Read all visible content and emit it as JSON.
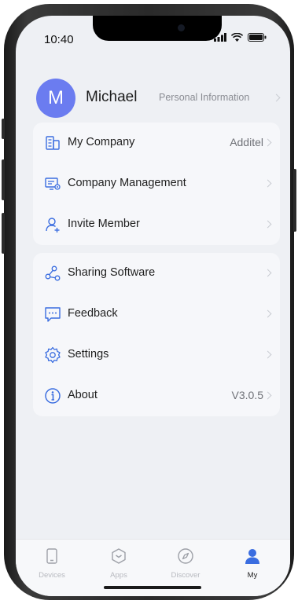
{
  "status": {
    "time": "10:40"
  },
  "profile": {
    "initial": "M",
    "name": "Michael",
    "link": "Personal Information"
  },
  "menu_group1": [
    {
      "label": "My Company",
      "value": "Additel",
      "icon": "company-icon"
    },
    {
      "label": "Company Management",
      "value": "",
      "icon": "company-management-icon"
    },
    {
      "label": "Invite Member",
      "value": "",
      "icon": "invite-member-icon"
    }
  ],
  "menu_group2": [
    {
      "label": "Sharing Software",
      "value": "",
      "icon": "share-icon"
    },
    {
      "label": "Feedback",
      "value": "",
      "icon": "feedback-icon"
    },
    {
      "label": "Settings",
      "value": "",
      "icon": "settings-icon"
    },
    {
      "label": "About",
      "value": "V3.0.5",
      "icon": "info-icon"
    }
  ],
  "tabs": [
    {
      "label": "Devices",
      "icon": "devices-icon",
      "active": false
    },
    {
      "label": "Apps",
      "icon": "apps-icon",
      "active": false
    },
    {
      "label": "Discover",
      "icon": "discover-icon",
      "active": false
    },
    {
      "label": "My",
      "icon": "user-icon",
      "active": true
    }
  ],
  "colors": {
    "accent": "#3a6de0",
    "avatar": "#6b7cf0",
    "background": "#eef0f4",
    "card": "#f6f7fa"
  }
}
